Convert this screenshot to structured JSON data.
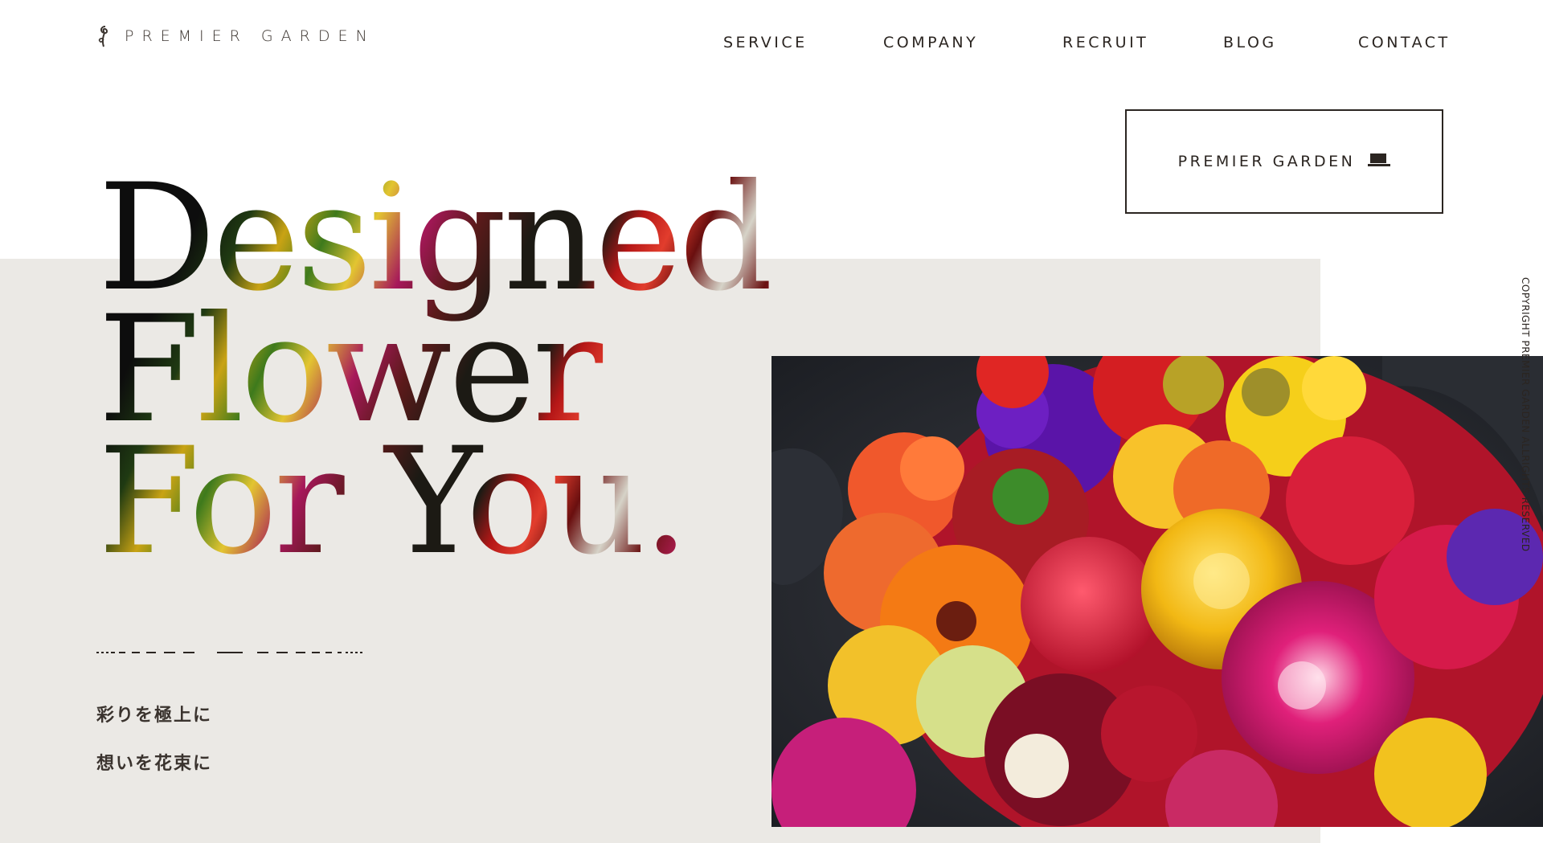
{
  "brand": {
    "name": "PREMIER GARDEN"
  },
  "nav": {
    "items": [
      {
        "label": "SERVICE"
      },
      {
        "label": "COMPANY"
      },
      {
        "label": "RECRUIT"
      },
      {
        "label": "BLOG"
      },
      {
        "label": "CONTACT"
      }
    ]
  },
  "cta_button": {
    "label": "PREMIER GARDEN",
    "icon": "laptop-icon"
  },
  "hero": {
    "headline_lines": [
      "Designed",
      "Flower",
      "For You."
    ],
    "taglines": [
      "彩りを極上に",
      "想いを花束に"
    ],
    "image_subject": "flower-bouquet-photo"
  },
  "copyright": "COPYRIGHT PREMIER GARDEN ALLRIGHTS RESERVED",
  "colors": {
    "text": "#2b2521",
    "band": "#ebe9e5",
    "background": "#ffffff"
  }
}
